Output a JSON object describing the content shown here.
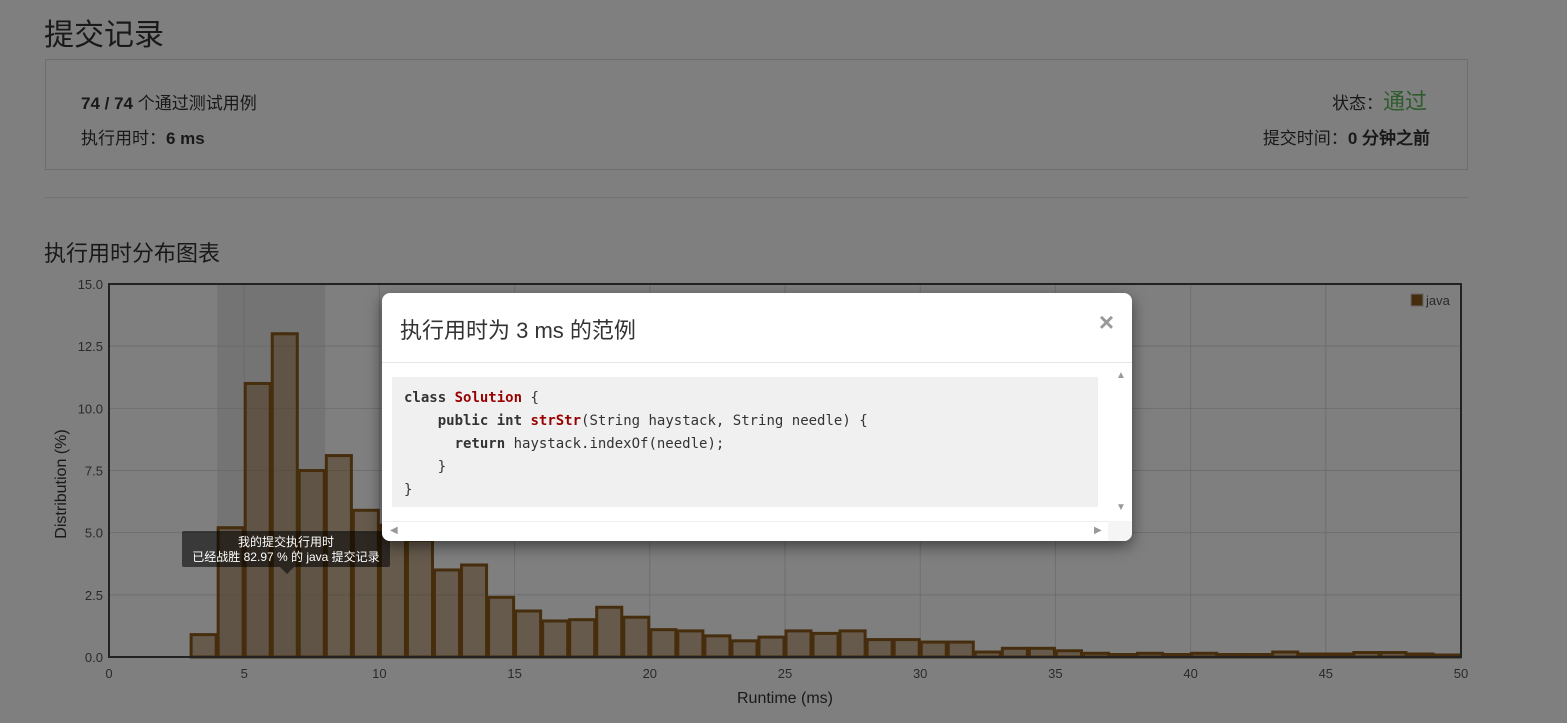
{
  "page": {
    "title": "提交记录"
  },
  "summary": {
    "passed_count": "74 / 74",
    "passed_suffix": " 个通过测试用例",
    "runtime_label": "执行用时：",
    "runtime_value": "6 ms",
    "status_label": "状态：",
    "status_value": "通过",
    "submit_time_label": "提交时间：",
    "submit_time_value": "0 分钟之前",
    "status_color": "#5cb85c"
  },
  "chart_section": {
    "title": "执行用时分布图表"
  },
  "chart_data": {
    "type": "bar",
    "xlabel": "Runtime (ms)",
    "ylabel": "Distribution (%)",
    "xlim": [
      0,
      50
    ],
    "ylim": [
      0,
      15
    ],
    "xticks": [
      "0",
      "5",
      "10",
      "15",
      "20",
      "25",
      "30",
      "35",
      "40",
      "45",
      "50"
    ],
    "yticks": [
      "0.0",
      "2.5",
      "5.0",
      "7.5",
      "10.0",
      "12.5",
      "15.0"
    ],
    "grid": true,
    "legend": "top-right",
    "series": [
      {
        "name": "java",
        "color": "#8b5a1a",
        "bin_width": 1,
        "bin_starts": [
          3,
          4,
          5,
          6,
          7,
          8,
          9,
          10,
          11,
          12,
          13,
          14,
          15,
          16,
          17,
          18,
          19,
          20,
          21,
          22,
          23,
          24,
          25,
          26,
          27,
          28,
          29,
          30,
          31,
          32,
          33,
          34,
          35,
          36,
          37,
          38,
          39,
          40,
          41,
          42,
          43,
          44,
          45,
          46,
          47,
          48,
          49
        ],
        "values": [
          0.9,
          5.2,
          11.0,
          13.0,
          7.5,
          8.1,
          5.9,
          5.3,
          4.7,
          3.5,
          3.7,
          2.4,
          1.85,
          1.45,
          1.5,
          2.0,
          1.6,
          1.1,
          1.05,
          0.85,
          0.65,
          0.8,
          1.05,
          0.95,
          1.05,
          0.7,
          0.7,
          0.6,
          0.6,
          0.2,
          0.35,
          0.35,
          0.25,
          0.15,
          0.1,
          0.15,
          0.1,
          0.15,
          0.1,
          0.1,
          0.2,
          0.12,
          0.12,
          0.18,
          0.18,
          0.12,
          0.08
        ]
      }
    ],
    "highlight_range": [
      4,
      8
    ]
  },
  "tooltip": {
    "line1": "我的提交执行用时",
    "line2": "已经战胜 82.97 % 的 java 提交记录"
  },
  "modal": {
    "title": "执行用时为 3 ms 的范例",
    "close": "×",
    "code": {
      "l1_kw": "class",
      "l1_name": "Solution",
      "l1_rest": " {",
      "l2_kw1": "public",
      "l2_kw2": "int",
      "l2_fn": "strStr",
      "l2_rest": "(String haystack, String needle) {",
      "l3_kw": "return",
      "l3_rest": " haystack.indexOf(needle);",
      "l4": "    }",
      "l5": "}"
    }
  }
}
